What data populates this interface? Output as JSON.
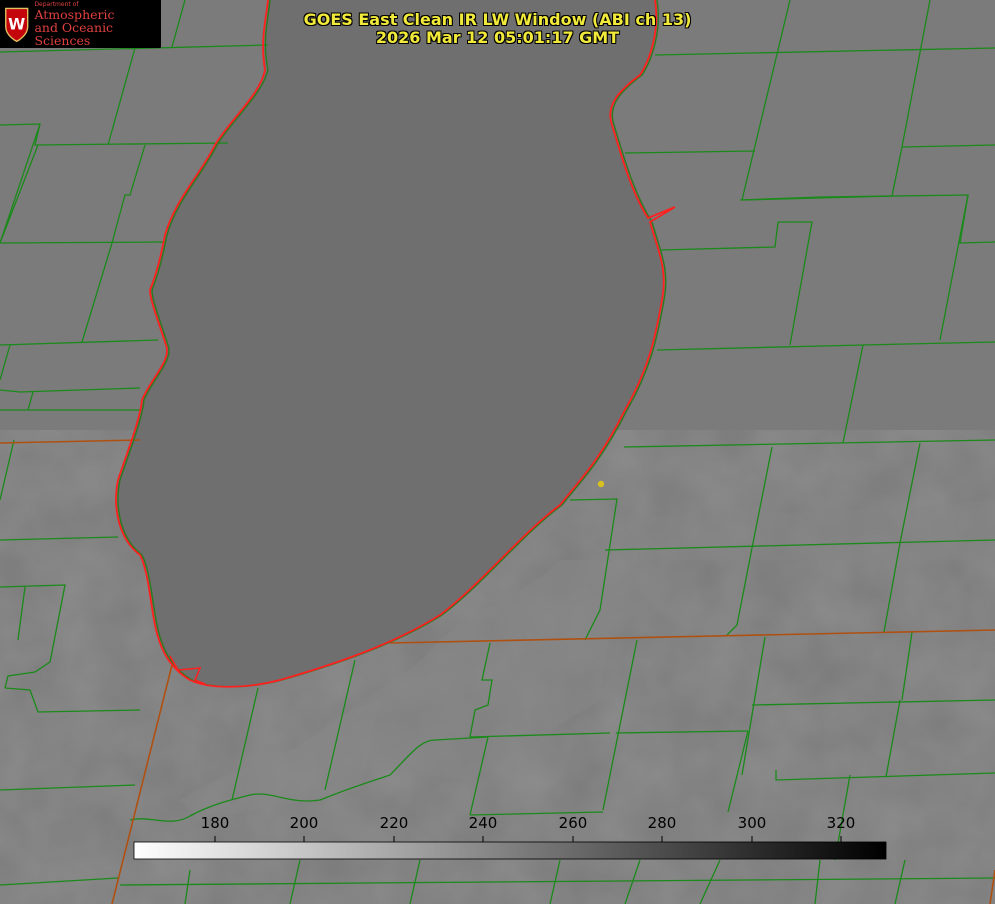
{
  "header": {
    "title_line1": "GOES East Clean IR LW Window (ABI ch 13)",
    "title_line2": "2026 Mar 12 05:01:17 GMT"
  },
  "logo": {
    "department": "Department of",
    "line1": "Atmospheric",
    "line2": "and Oceanic Sciences",
    "crest_letter": "W"
  },
  "colorbar": {
    "ticks": [
      "180",
      "200",
      "220",
      "240",
      "260",
      "280",
      "300",
      "320"
    ],
    "gradient_start": "#ffffff",
    "gradient_end": "#000000"
  },
  "colors": {
    "title": "#f2ea3a",
    "county_lines": "#1a8a1a",
    "coastline": "#ff2020",
    "state_lines": "#b05010",
    "city_marker": "#d8c020",
    "land": "#7d7d7d",
    "lake": "#6e6e6e"
  }
}
